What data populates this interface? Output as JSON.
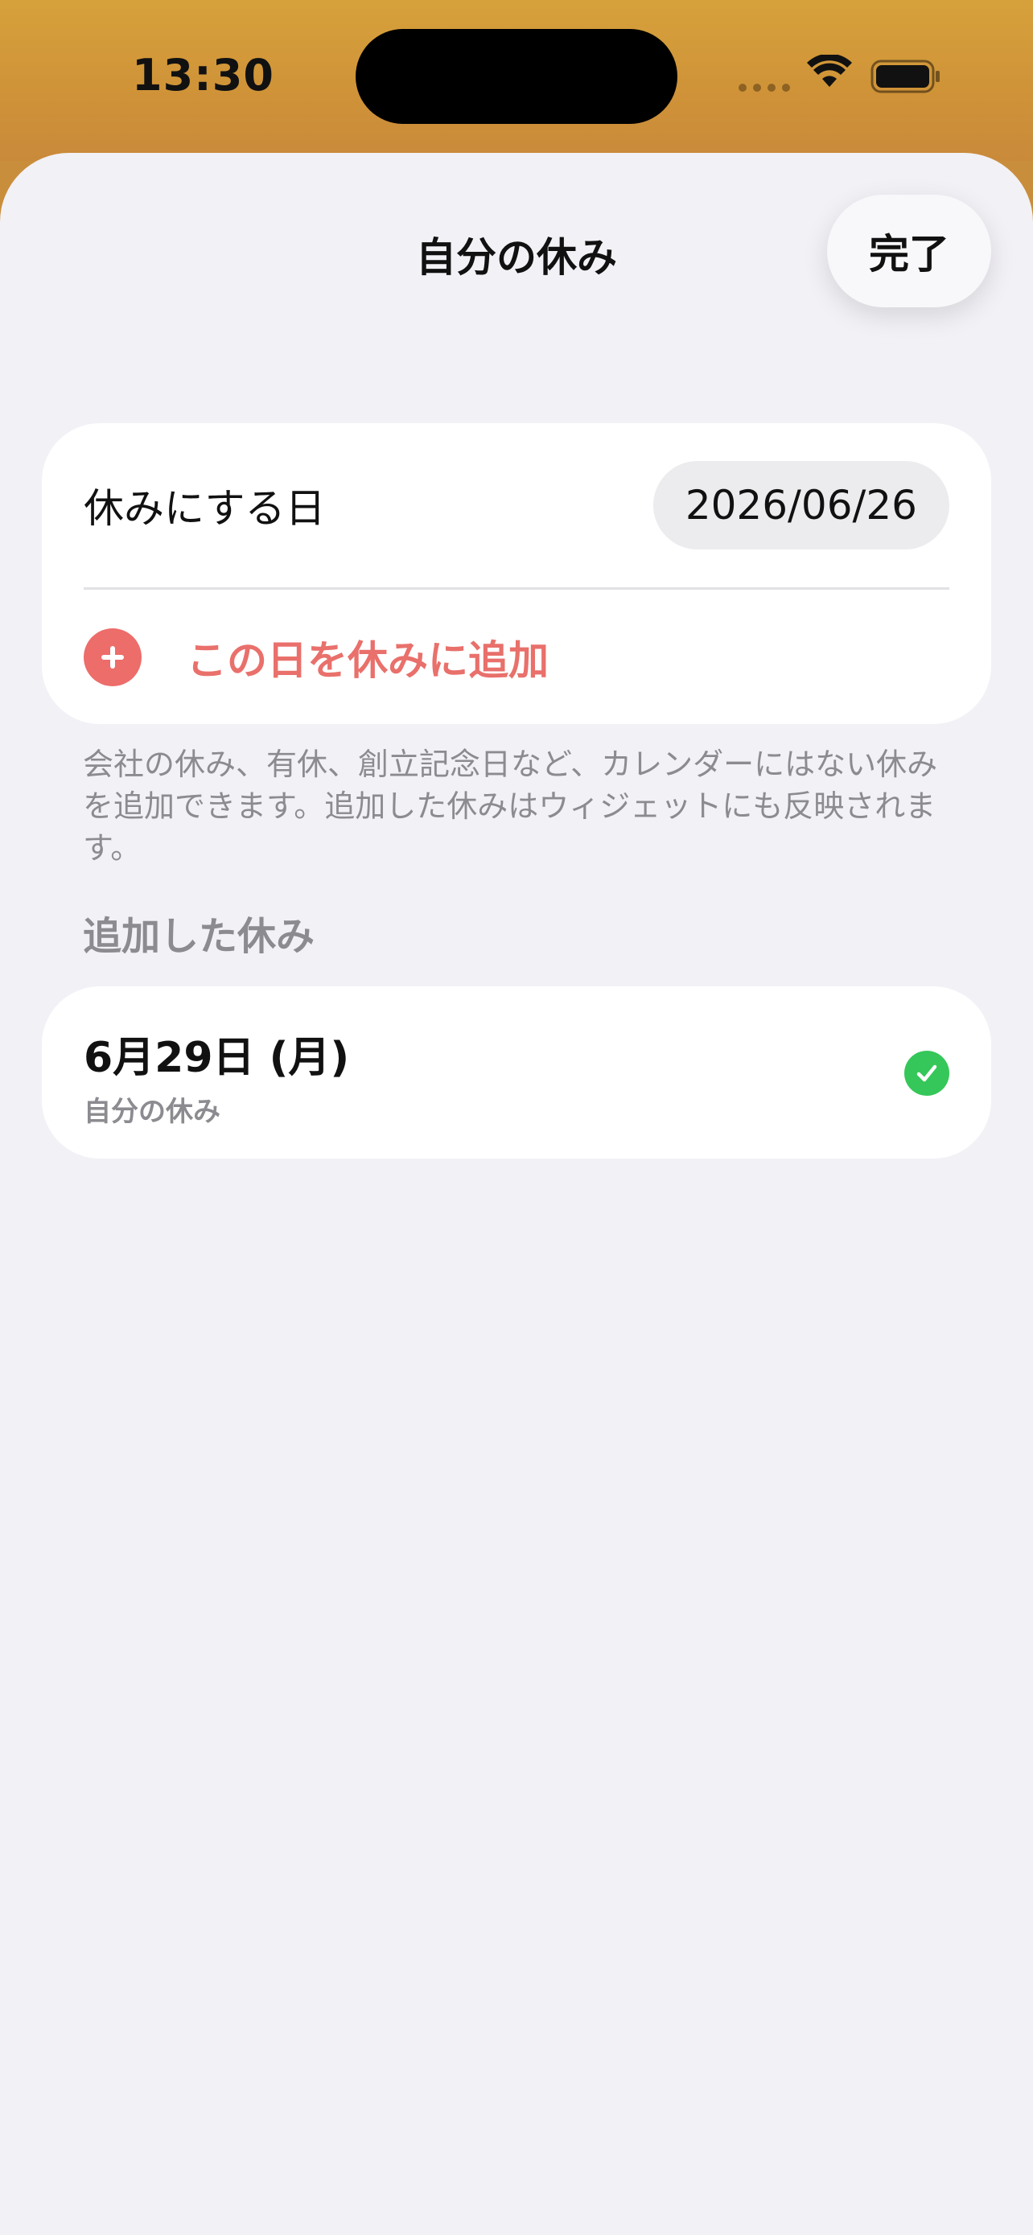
{
  "status_bar": {
    "time": "13:30"
  },
  "sheet": {
    "title": "自分の休み",
    "done_label": "完了"
  },
  "date_section": {
    "label": "休みにする日",
    "date_value": "2026/06/26",
    "add_label": "この日を休みに追加",
    "help_text": "会社の休み、有休、創立記念日など、カレンダーにはない休みを追加できます。追加した休みはウィジェットにも反映されます。"
  },
  "added_section": {
    "header": "追加した休み",
    "items": [
      {
        "title": "6月29日 (月)",
        "subtitle": "自分の休み"
      }
    ]
  },
  "colors": {
    "accent": "#ec6d6a",
    "check": "#35c759",
    "background": "#f2f1f6",
    "status_bar": "#d09539"
  }
}
